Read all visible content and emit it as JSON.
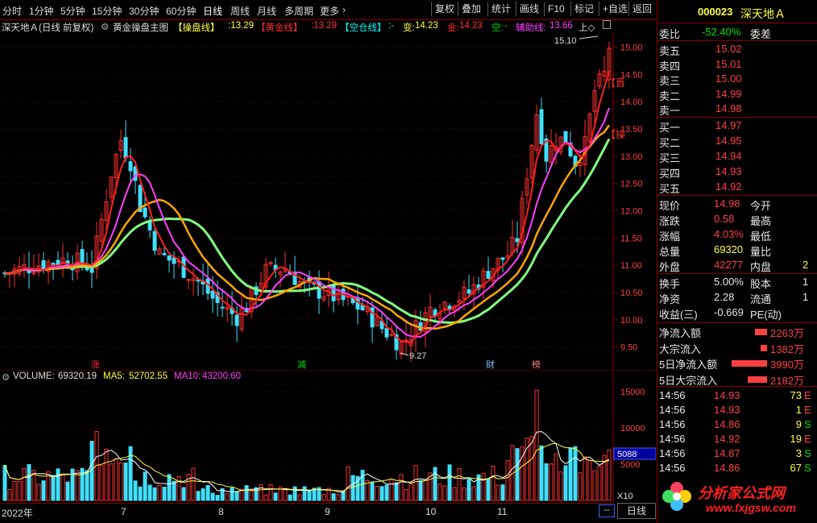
{
  "toolbar": {
    "periods": [
      "分时",
      "1分钟",
      "5分钟",
      "15分钟",
      "30分钟",
      "60分钟",
      "日线",
      "周线",
      "月线",
      "多周期",
      "更多"
    ],
    "more_arrow": "›",
    "buttons": [
      "复权",
      "叠加",
      "统计",
      "画线",
      "F10",
      "标记",
      "+自选",
      "返回"
    ]
  },
  "info": {
    "stock_title": "深天地Ａ(日线 前复权)",
    "indicator_name": "黄金操盘主图",
    "line1_label": "【操盘线】",
    "line1_value": ":13.29",
    "line2_label": "【黄金线】",
    "line2_value": ":13.29",
    "line3_label": "【空仓线】",
    "line3_value": ":-",
    "change_label": "变:",
    "change_value": "14.23",
    "gold_label": "金:",
    "gold_value": "14.23",
    "empty_label": "空:",
    "empty_value": "-",
    "aux_label": "辅助线:",
    "aux_value": "13.66",
    "up_label": "上◇"
  },
  "price_axis": [
    "15.00",
    "14.50",
    "14.00",
    "13.50",
    "13.00",
    "12.50",
    "12.00",
    "11.50",
    "11.00",
    "10.50",
    "10.00",
    "9.50"
  ],
  "price_marks": {
    "high": "15.10",
    "low": "9.27"
  },
  "side_tags": {
    "tag1": "【晋",
    "tag2": "【操"
  },
  "event_labels": [
    "涨",
    "减",
    "财",
    "榜"
  ],
  "volume": {
    "header_label": "VOLUME:",
    "volume_value": "69320.19",
    "ma5_label": "MA5:",
    "ma5_value": "52702.55",
    "ma10_label": "MA10:",
    "ma10_value": "43200.60",
    "axis": [
      "15000",
      "10000",
      "5000"
    ],
    "current_box": "5088",
    "multiplier": "X10"
  },
  "xaxis": {
    "labels": [
      "2022年",
      "7",
      "8",
      "9",
      "10",
      "11"
    ],
    "period_button": "日线",
    "scroll_label": "--"
  },
  "quote": {
    "code": "000023",
    "name": "深天地Ａ",
    "weibi_label": "委比",
    "weibi_value": "-52.40%",
    "weicha_label": "委差",
    "asks": [
      {
        "label": "卖五",
        "price": "15.02"
      },
      {
        "label": "卖四",
        "price": "15.01"
      },
      {
        "label": "卖三",
        "price": "15.00"
      },
      {
        "label": "卖二",
        "price": "14.99"
      },
      {
        "label": "卖一",
        "price": "14.98"
      }
    ],
    "bids": [
      {
        "label": "买一",
        "price": "14.97"
      },
      {
        "label": "买二",
        "price": "14.95"
      },
      {
        "label": "买三",
        "price": "14.94"
      },
      {
        "label": "买四",
        "price": "14.93"
      },
      {
        "label": "买五",
        "price": "14.92"
      }
    ],
    "stats": [
      {
        "label": "现价",
        "value": "14.98",
        "label2": "今开",
        "value2": ""
      },
      {
        "label": "涨跌",
        "value": "0.58",
        "label2": "最高",
        "value2": ""
      },
      {
        "label": "涨幅",
        "value": "4.03%",
        "label2": "最低",
        "value2": ""
      },
      {
        "label": "总量",
        "value": "69320",
        "label2": "量比",
        "value2": ""
      },
      {
        "label": "外盘",
        "value": "42277",
        "label2": "内盘",
        "value2": "2"
      }
    ],
    "stats2": [
      {
        "label": "换手",
        "value": "5.00%",
        "label2": "股本",
        "value2": "1"
      },
      {
        "label": "净资",
        "value": "2.28",
        "label2": "流通",
        "value2": "1"
      },
      {
        "label": "收益(三)",
        "value": "-0.669",
        "label2": "PE(动)",
        "value2": ""
      }
    ],
    "flows": [
      {
        "label": "净流入额",
        "bar": 0.35,
        "value": "2263万"
      },
      {
        "label": "大宗流入",
        "bar": 0.18,
        "value": "1382万"
      },
      {
        "label": "5日净流入额",
        "bar": 1.0,
        "value": "3990万"
      },
      {
        "label": "5日大宗流入",
        "bar": 0.55,
        "value": "2182万"
      }
    ],
    "ticks": [
      {
        "time": "14:56",
        "price": "14.93",
        "vol": "73",
        "flag": "E"
      },
      {
        "time": "14:56",
        "price": "14.93",
        "vol": "1",
        "flag": "E"
      },
      {
        "time": "14:56",
        "price": "14.86",
        "vol": "9",
        "flag": "S"
      },
      {
        "time": "14:56",
        "price": "14.92",
        "vol": "19",
        "flag": "E"
      },
      {
        "time": "14:56",
        "price": "14.87",
        "vol": "3",
        "flag": "S"
      },
      {
        "time": "14:56",
        "price": "14.86",
        "vol": "67",
        "flag": "S"
      }
    ],
    "brand_cn": "分析家公式网",
    "brand_url": "www.fxjgsw.com"
  },
  "chart_data": {
    "type": "candlestick",
    "price_range": [
      9.2,
      15.2
    ],
    "volume_range": [
      0,
      16000
    ],
    "colors": {
      "up": "#ff3030",
      "down": "#40e0ff",
      "ma_gold": "#ffa500",
      "ma_main": "#ff2020",
      "ma_aux": "#ff40ff",
      "ma_cloud": "#80ff80"
    }
  }
}
